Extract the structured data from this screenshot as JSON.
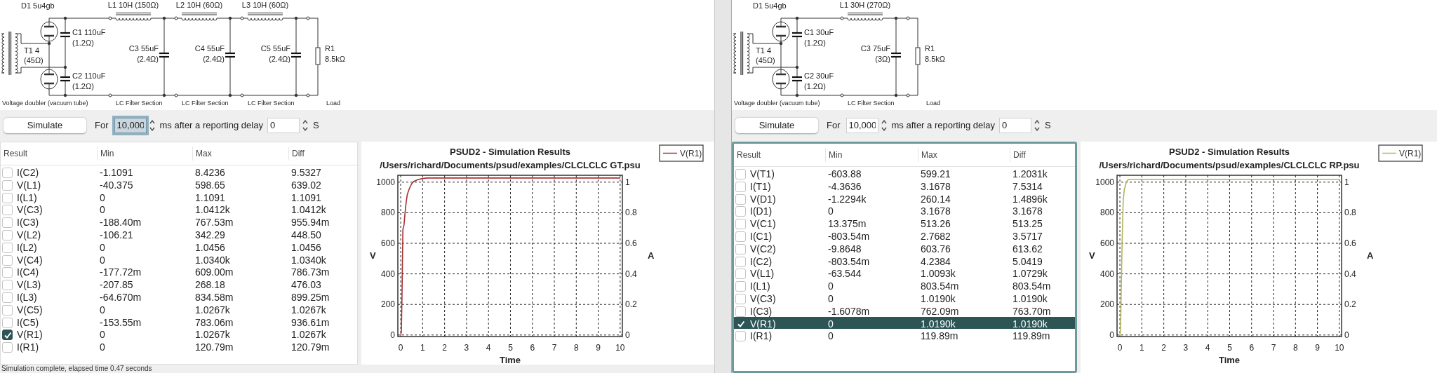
{
  "windows": [
    {
      "schematic": {
        "rectifier": {
          "diode": "D1 5u4gb",
          "transformer": "T1 4",
          "transformer_resistance": "(45Ω)",
          "caps": [
            {
              "name": "C1 110uF",
              "esr": "(1.2Ω)"
            },
            {
              "name": "C2 110uF",
              "esr": "(1.2Ω)"
            }
          ],
          "caption": "Voltage doubler (vacuum tube)"
        },
        "filters": [
          {
            "inductor": "L1 10H (150Ω)",
            "cap": "C3 55uF",
            "esr": "(2.4Ω)",
            "caption": "LC Filter Section"
          },
          {
            "inductor": "L2 10H (60Ω)",
            "cap": "C4 55uF",
            "esr": "(2.4Ω)",
            "caption": "LC Filter Section"
          },
          {
            "inductor": "L3 10H (60Ω)",
            "cap": "C5 55uF",
            "esr": "(2.4Ω)",
            "caption": "LC Filter Section"
          }
        ],
        "load": {
          "name": "R1",
          "value": "8.5kΩ",
          "caption": "Load"
        }
      },
      "controls": {
        "button": "Simulate",
        "for_label": "For",
        "duration": {
          "value": "10,000",
          "focused": true
        },
        "unit_label": "ms after a reporting delay",
        "delay": {
          "value": "0",
          "focused": false
        },
        "delay_unit": "S"
      },
      "table": {
        "focused": false,
        "columns": [
          "Result",
          "Min",
          "Max",
          "Diff"
        ],
        "rows": [
          {
            "cells": [
              "I(C2)",
              "-1.1091",
              "8.4236",
              "9.5327"
            ],
            "checked": false,
            "selected": false
          },
          {
            "cells": [
              "V(L1)",
              "-40.375",
              "598.65",
              "639.02"
            ],
            "checked": false,
            "selected": false
          },
          {
            "cells": [
              "I(L1)",
              "0",
              "1.1091",
              "1.1091"
            ],
            "checked": false,
            "selected": false
          },
          {
            "cells": [
              "V(C3)",
              "0",
              "1.0412k",
              "1.0412k"
            ],
            "checked": false,
            "selected": false
          },
          {
            "cells": [
              "I(C3)",
              "-188.40m",
              "767.53m",
              "955.94m"
            ],
            "checked": false,
            "selected": false
          },
          {
            "cells": [
              "V(L2)",
              "-106.21",
              "342.29",
              "448.50"
            ],
            "checked": false,
            "selected": false
          },
          {
            "cells": [
              "I(L2)",
              "0",
              "1.0456",
              "1.0456"
            ],
            "checked": false,
            "selected": false
          },
          {
            "cells": [
              "V(C4)",
              "0",
              "1.0340k",
              "1.0340k"
            ],
            "checked": false,
            "selected": false
          },
          {
            "cells": [
              "I(C4)",
              "-177.72m",
              "609.00m",
              "786.73m"
            ],
            "checked": false,
            "selected": false
          },
          {
            "cells": [
              "V(L3)",
              "-207.85",
              "268.18",
              "476.03"
            ],
            "checked": false,
            "selected": false
          },
          {
            "cells": [
              "I(L3)",
              "-64.670m",
              "834.58m",
              "899.25m"
            ],
            "checked": false,
            "selected": false
          },
          {
            "cells": [
              "V(C5)",
              "0",
              "1.0267k",
              "1.0267k"
            ],
            "checked": false,
            "selected": false
          },
          {
            "cells": [
              "I(C5)",
              "-153.55m",
              "783.06m",
              "936.61m"
            ],
            "checked": false,
            "selected": false
          },
          {
            "cells": [
              "V(R1)",
              "0",
              "1.0267k",
              "1.0267k"
            ],
            "checked": true,
            "selected": false
          },
          {
            "cells": [
              "I(R1)",
              "0",
              "120.79m",
              "120.79m"
            ],
            "checked": false,
            "selected": false
          }
        ]
      },
      "chart_data": {
        "type": "line",
        "title": "PSUD2 - Simulation Results",
        "subtitle": "/Users/richard/Documents/psud/examples/CLCLCLC GT.psu",
        "xlabel": "Time",
        "ylabel": "V",
        "y2label": "A",
        "x": [
          0,
          0.03,
          0.06,
          0.1,
          0.15,
          0.2,
          0.25,
          0.3,
          0.4,
          0.5,
          0.6,
          0.8,
          1,
          1.2,
          2,
          4,
          6,
          8,
          10
        ],
        "series": [
          {
            "name": "V(R1)",
            "color": "#a83232",
            "values": [
              0,
              20,
              250,
              690,
              720,
              800,
              870,
              920,
              960,
              990,
              1005,
              1018,
              1024,
              1027,
              1027,
              1027,
              1027,
              1027,
              1027
            ]
          }
        ],
        "xlim": [
          -0.13,
          10.1
        ],
        "ylim": [
          -10,
          1045
        ],
        "y2lim": [
          -0.01,
          1.045
        ],
        "grid": true,
        "xticks": [
          0,
          1,
          2,
          3,
          4,
          5,
          6,
          7,
          8,
          9,
          10
        ],
        "yticks": [
          0,
          200,
          400,
          600,
          800,
          1000
        ],
        "y2ticks": [
          0,
          0.2,
          0.4,
          0.6,
          0.8,
          1
        ]
      },
      "status": "Simulation complete, elapsed time 0.47 seconds"
    },
    {
      "schematic": {
        "rectifier": {
          "diode": "D1 5u4gb",
          "transformer": "T1 4",
          "transformer_resistance": "(45Ω)",
          "caps": [
            {
              "name": "C1 30uF",
              "esr": "(1.2Ω)"
            },
            {
              "name": "C2 30uF",
              "esr": "(1.2Ω)"
            }
          ],
          "caption": "Voltage doubler (vacuum tube)"
        },
        "filters": [
          {
            "inductor": "L1 30H (270Ω)",
            "cap": "C3 75uF",
            "esr": "(3Ω)",
            "caption": "LC Filter Section"
          }
        ],
        "load": {
          "name": "R1",
          "value": "8.5kΩ",
          "caption": "Load"
        }
      },
      "controls": {
        "button": "Simulate",
        "for_label": "For",
        "duration": {
          "value": "10,000",
          "focused": false
        },
        "unit_label": "ms after a reporting delay",
        "delay": {
          "value": "0",
          "focused": false
        },
        "delay_unit": "S"
      },
      "table": {
        "focused": true,
        "columns": [
          "Result",
          "Min",
          "Max",
          "Diff"
        ],
        "rows": [
          {
            "cells": [
              "V(T1)",
              "-603.88",
              "599.21",
              "1.2031k"
            ],
            "checked": false,
            "selected": false
          },
          {
            "cells": [
              "I(T1)",
              "-4.3636",
              "3.1678",
              "7.5314"
            ],
            "checked": false,
            "selected": false
          },
          {
            "cells": [
              "V(D1)",
              "-1.2294k",
              "260.14",
              "1.4896k"
            ],
            "checked": false,
            "selected": false
          },
          {
            "cells": [
              "I(D1)",
              "0",
              "3.1678",
              "3.1678"
            ],
            "checked": false,
            "selected": false
          },
          {
            "cells": [
              "V(C1)",
              "13.375m",
              "513.26",
              "513.25"
            ],
            "checked": false,
            "selected": false
          },
          {
            "cells": [
              "I(C1)",
              "-803.54m",
              "2.7682",
              "3.5717"
            ],
            "checked": false,
            "selected": false
          },
          {
            "cells": [
              "V(C2)",
              "-9.8648",
              "603.76",
              "613.62"
            ],
            "checked": false,
            "selected": false
          },
          {
            "cells": [
              "I(C2)",
              "-803.54m",
              "4.2384",
              "5.0419"
            ],
            "checked": false,
            "selected": false
          },
          {
            "cells": [
              "V(L1)",
              "-63.544",
              "1.0093k",
              "1.0729k"
            ],
            "checked": false,
            "selected": false
          },
          {
            "cells": [
              "I(L1)",
              "0",
              "803.54m",
              "803.54m"
            ],
            "checked": false,
            "selected": false
          },
          {
            "cells": [
              "V(C3)",
              "0",
              "1.0190k",
              "1.0190k"
            ],
            "checked": false,
            "selected": false
          },
          {
            "cells": [
              "I(C3)",
              "-1.6078m",
              "762.09m",
              "763.70m"
            ],
            "checked": false,
            "selected": false
          },
          {
            "cells": [
              "V(R1)",
              "0",
              "1.0190k",
              "1.0190k"
            ],
            "checked": true,
            "selected": true
          },
          {
            "cells": [
              "I(R1)",
              "0",
              "119.89m",
              "119.89m"
            ],
            "checked": false,
            "selected": false
          }
        ]
      },
      "chart_data": {
        "type": "line",
        "title": "PSUD2 - Simulation Results",
        "subtitle": "/Users/richard/Documents/psud/examples/CLCLCLC RP.psu",
        "xlabel": "Time",
        "ylabel": "V",
        "y2label": "A",
        "x": [
          0,
          0.03,
          0.06,
          0.1,
          0.15,
          0.2,
          0.3,
          0.4,
          0.5,
          1,
          10
        ],
        "series": [
          {
            "name": "V(R1)",
            "color": "#b3b35a",
            "values": [
              0,
              30,
              280,
              600,
              880,
              950,
              1005,
              1018,
              1019,
              1019,
              1019
            ]
          }
        ],
        "xlim": [
          -0.13,
          10.1
        ],
        "ylim": [
          -10,
          1045
        ],
        "y2lim": [
          -0.01,
          1.045
        ],
        "grid": true,
        "xticks": [
          0,
          1,
          2,
          3,
          4,
          5,
          6,
          7,
          8,
          9,
          10
        ],
        "yticks": [
          0,
          200,
          400,
          600,
          800,
          1000
        ],
        "y2ticks": [
          0,
          0.2,
          0.4,
          0.6,
          0.8,
          1
        ]
      }
    }
  ]
}
